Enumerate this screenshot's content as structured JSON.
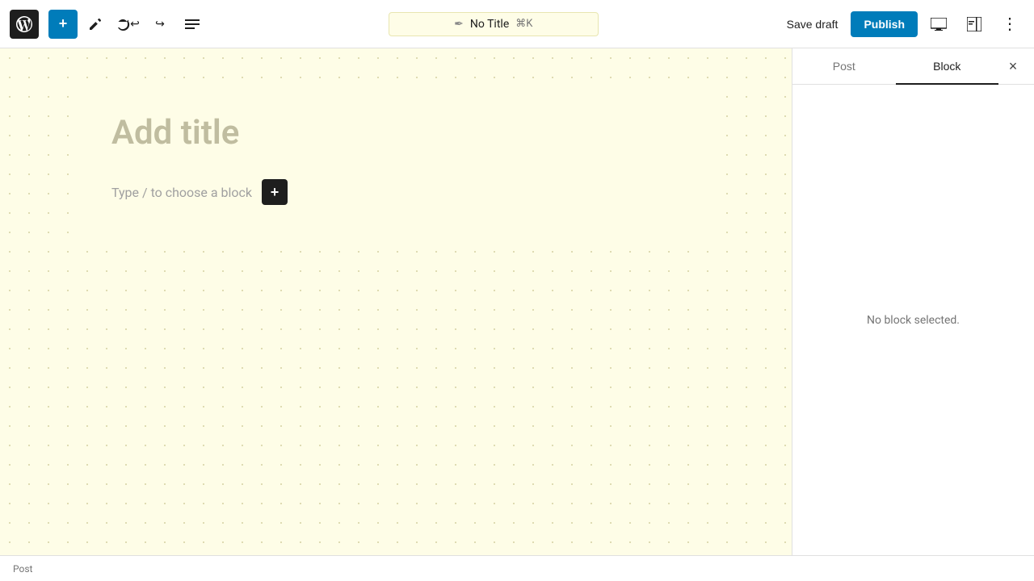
{
  "toolbar": {
    "add_label": "+",
    "undo_label": "↩",
    "redo_label": "↪",
    "tools_label": "≡",
    "pencil_label": "✏"
  },
  "command_bar": {
    "icon": "✒",
    "title": "No Title",
    "shortcut": "⌘K"
  },
  "toolbar_right": {
    "save_draft_label": "Save draft",
    "publish_label": "Publish",
    "view_label": "□",
    "settings_label": "⊞",
    "more_label": "⋮"
  },
  "editor": {
    "title_placeholder": "Add title",
    "block_placeholder": "Type / to choose a block",
    "add_block_label": "+"
  },
  "sidebar": {
    "tab_post": "Post",
    "tab_block": "Block",
    "no_block_selected": "No block selected."
  },
  "status_bar": {
    "text": "Post"
  },
  "icons": {
    "wp_logo": "W",
    "close": "×",
    "pencil": "✎",
    "monitor": "▭",
    "grid": "⊞"
  }
}
